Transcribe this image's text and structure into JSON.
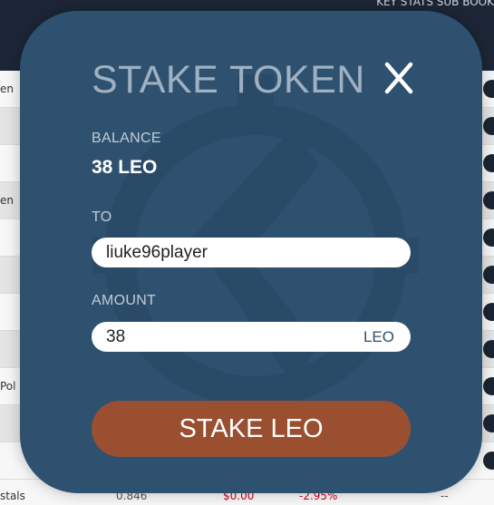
{
  "background": {
    "header_text": "KEY STATS SUB BOOK",
    "rows": [
      {
        "label": "en"
      },
      {
        "label": ""
      },
      {
        "label": ""
      },
      {
        "label": "en"
      },
      {
        "label": ""
      },
      {
        "label": ""
      },
      {
        "label": ""
      },
      {
        "label": ""
      },
      {
        "label": "Pol"
      },
      {
        "label": ""
      },
      {
        "label": ""
      }
    ],
    "bottom_row": {
      "name": "stals",
      "value": "0.846",
      "amount": "$0.00",
      "change": "-2.95%",
      "extra": "--"
    }
  },
  "modal": {
    "title": "STAKE TOKEN",
    "close_label": "X",
    "balance": {
      "label": "BALANCE",
      "value": "38 LEO"
    },
    "to": {
      "label": "TO",
      "value": "liuke96player"
    },
    "amount": {
      "label": "AMOUNT",
      "value": "38",
      "unit": "LEO"
    },
    "submit_label": "STAKE LEO"
  },
  "colors": {
    "modal_bg": "#2e5170",
    "title": "#9fb0c1",
    "button": "#9a4f30",
    "negative": "#d0021b"
  }
}
